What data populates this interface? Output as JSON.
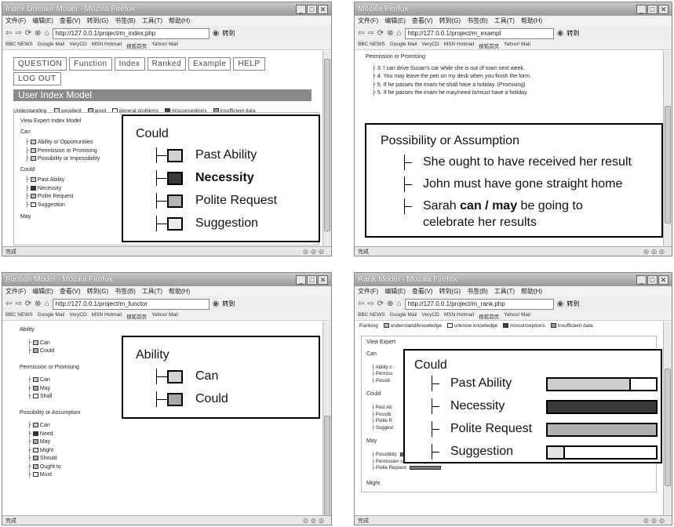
{
  "win1": {
    "title": "Index Domain Model - Mozilla Firefox",
    "menu": [
      "文件(F)",
      "编辑(E)",
      "查看(V)",
      "转到(G)",
      "书签(B)",
      "工具(T)",
      "帮助(H)"
    ],
    "url": "http://127.0.0.1/project/m_index.php",
    "go": "转到",
    "bookmarks": [
      "BBC NEWS",
      "Google Mail",
      "VeryCD",
      "MSN Hotmail",
      "搜狐首页",
      "Yahoo! Mail"
    ],
    "buttons": [
      "QUESTION",
      "Function",
      "Index",
      "Ranked",
      "Example",
      "HELP",
      "LOG OUT"
    ],
    "header": "User Index Model",
    "legend": {
      "label": "Understanding",
      "items": [
        "excellent",
        "good",
        "general problems",
        "misconceptions",
        "insufficient data"
      ]
    },
    "view_title": "View Expert Index Model",
    "groups": [
      {
        "name": "Can",
        "items": [
          "Ability or Opportunities",
          "Permission or Promising",
          "Possibility or Impossibility"
        ]
      },
      {
        "name": "Could",
        "items": [
          "Past Ability",
          "Necessity",
          "Polite Request",
          "Suggestion"
        ]
      },
      {
        "name": "May",
        "items": []
      }
    ],
    "overlay": {
      "title": "Could",
      "items": [
        {
          "label": "Past Ability",
          "color": "#d2d2d2",
          "bold": false
        },
        {
          "label": "Necessity",
          "color": "#3a3a3a",
          "bold": true
        },
        {
          "label": "Polite Request",
          "color": "#b4b4b4",
          "bold": false
        },
        {
          "label": "Suggestion",
          "color": "#ececec",
          "bold": false
        }
      ]
    },
    "status": "完成"
  },
  "win2": {
    "title": "Mozilla Firefox",
    "menu": [
      "文件(F)",
      "编辑(E)",
      "查看(V)",
      "转到(G)",
      "书签(B)",
      "工具(T)",
      "帮助(H)"
    ],
    "url": "http://127.0.0.1/project/m_exampl",
    "go": "转到",
    "bookmarks": [
      "BBC NEWS",
      "Google Mail",
      "VeryCD",
      "MSN Hotmail",
      "搜狐首页",
      "Yahoo! Mail"
    ],
    "section": "Permission or Promising",
    "examples": [
      "3. I can drive Susan's car while she is out of town next week.",
      "4. You may leave the pen on my desk when you finish the form.",
      "5. If he passes the exam he shall have a holiday. (Promising)",
      "5. If he passes the exam he may/need to/must have a holiday."
    ],
    "overlay": {
      "title": "Possibility or Assumption",
      "items": [
        "She ought to have received her result",
        "John must have gone straight home"
      ],
      "last_pre": "Sarah",
      "last_bold": "can / may",
      "last_post": "be going to",
      "last_line2": "celebrate her results"
    },
    "status": "完成"
  },
  "win3": {
    "title": "Funtion Model - Mozilla Firefox",
    "menu": [
      "文件(F)",
      "编辑(E)",
      "查看(V)",
      "转到(G)",
      "书签(B)",
      "工具(T)",
      "帮助(H)"
    ],
    "url": "http://127.0.0.1/project/m_functor",
    "go": "转到",
    "bookmarks": [
      "BBC NEWS",
      "Google Mail",
      "VeryCD",
      "MSN Hotmail",
      "搜狐首页",
      "Yahoo! Mail"
    ],
    "groups": [
      {
        "name": "Ability",
        "items": [
          "Can",
          "Could"
        ]
      },
      {
        "name": "Permission or Promising",
        "items": [
          "Can",
          "May",
          "Shall"
        ]
      },
      {
        "name": "Possibility or Assumption",
        "items": [
          "Can",
          "Need",
          "May",
          "Might",
          "Should",
          "Ought to",
          "Must"
        ]
      }
    ],
    "overlay": {
      "title": "Ability",
      "items": [
        {
          "label": "Can",
          "color": "#d2d2d2"
        },
        {
          "label": "Could",
          "color": "#a8a8a8"
        }
      ]
    },
    "status": "完成"
  },
  "win4": {
    "title": "Rank Model - Mozilla Firefox",
    "menu": [
      "文件(F)",
      "编辑(E)",
      "查看(V)",
      "转到(G)",
      "书签(B)",
      "工具(T)",
      "帮助(H)"
    ],
    "url": "http://127.0.0.1/project/m_rank.php",
    "go": "转到",
    "bookmarks": [
      "BBC NEWS",
      "Google Mail",
      "VeryCD",
      "MSN Hotmail",
      "搜狐首页",
      "Yahoo! Mail"
    ],
    "legend": {
      "label": "Ranking",
      "items": [
        "understand/knowledge",
        "unknow knowledge",
        "misconceptions",
        "insufficient data"
      ]
    },
    "view_title": "View Expert",
    "groups": [
      {
        "name": "Can",
        "items": [
          "Ability o",
          "Permiss",
          "Possib"
        ]
      },
      {
        "name": "Could",
        "items": [
          "Past Ab",
          "Possibi",
          "Polite R",
          "Suggest"
        ]
      },
      {
        "name": "May",
        "items": [
          "Possibility",
          "Permission or Promising",
          "Polite Request"
        ]
      },
      {
        "name": "Might",
        "items": []
      }
    ],
    "may_bars": [
      0.55,
      0.7,
      0.4
    ],
    "overlay": {
      "title": "Could",
      "items": [
        {
          "label": "Past Ability",
          "value": 0.77,
          "color": "#cfcfcf"
        },
        {
          "label": "Necessity",
          "value": 1.0,
          "color": "#3a3a3a"
        },
        {
          "label": "Polite Request",
          "value": 1.0,
          "color": "#b0b0b0"
        },
        {
          "label": "Suggestion",
          "value": 0.16,
          "color": "#e4e4e4"
        }
      ]
    },
    "status": "完成"
  }
}
